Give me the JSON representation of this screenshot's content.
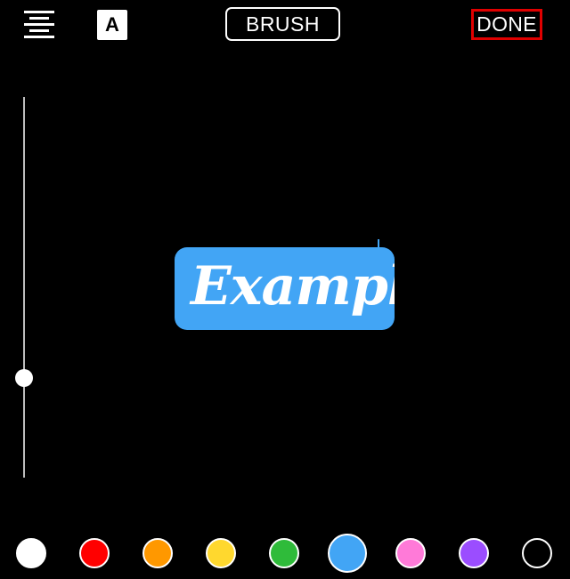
{
  "toolbar": {
    "align_icon": "align-center-icon",
    "font_label": "A",
    "brush_label": "BRUSH",
    "done_label": "DONE"
  },
  "slider": {
    "value": 0.25
  },
  "canvas": {
    "text": "Example",
    "text_color": "#ffffff",
    "background_color": "#42a5f5"
  },
  "palette": {
    "selected": 5,
    "colors": [
      "#ffffff",
      "#ff0000",
      "#ff9800",
      "#ffd82e",
      "#2fbb3a",
      "#42a5f5",
      "#ff7ad8",
      "#9b4dff",
      "#000000"
    ]
  }
}
